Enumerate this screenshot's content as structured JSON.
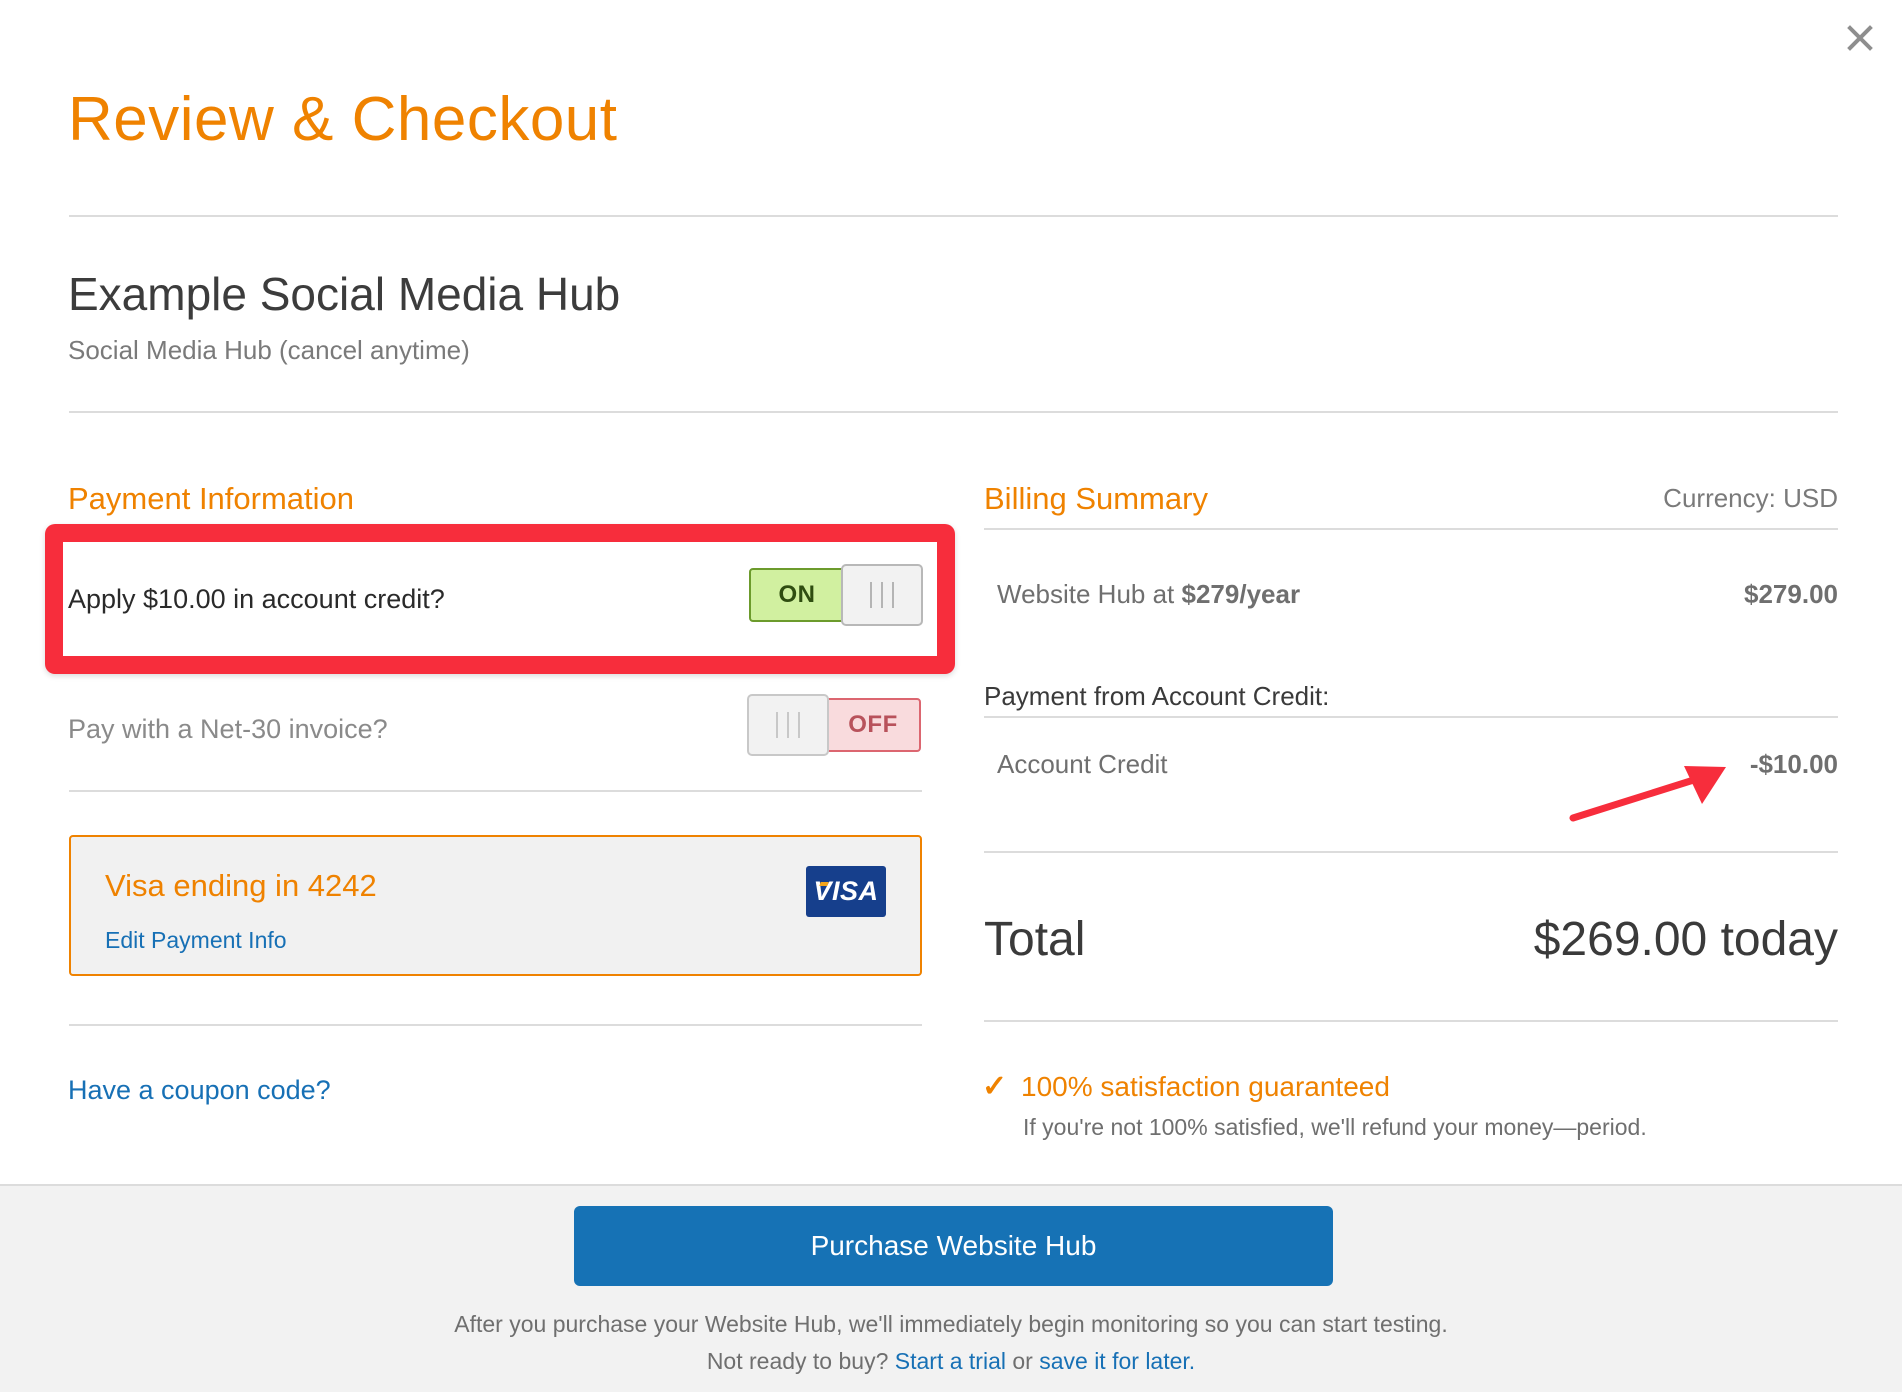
{
  "dialog": {
    "title": "Review & Checkout",
    "close_icon": "close-icon"
  },
  "product": {
    "name": "Example Social Media Hub",
    "subtitle": "Social Media Hub (cancel anytime)"
  },
  "payment": {
    "heading": "Payment Information",
    "credit_toggle": {
      "label": "Apply $10.00 in account credit?",
      "state": "ON",
      "on": true
    },
    "net30_toggle": {
      "label": "Pay with a Net-30 invoice?",
      "state": "OFF",
      "on": false
    },
    "card": {
      "label": "Visa ending in 4242",
      "edit_link": "Edit Payment Info",
      "brand": "VISA"
    },
    "coupon_link": "Have a coupon code?"
  },
  "billing": {
    "heading": "Billing Summary",
    "currency": "Currency: USD",
    "line_item": {
      "label_prefix": "Website Hub at ",
      "label_price": "$279/year",
      "amount": "$279.00"
    },
    "credit_section_heading": "Payment from Account Credit:",
    "credit_line": {
      "label": "Account Credit",
      "amount": "-$10.00"
    },
    "total_label": "Total",
    "total_amount": "$269.00 today",
    "guarantee": "100% satisfaction guaranteed",
    "guarantee_sub": "If you're not 100% satisfied, we'll refund your money—period."
  },
  "footer": {
    "purchase_button": "Purchase Website Hub",
    "text_1": "After you purchase your Website Hub, we'll immediately begin monitoring so you can start testing. Not ready to buy? ",
    "trial_link": "Start a trial",
    "text_2": " or ",
    "save_link": "save it for later."
  },
  "colors": {
    "accent": "#ef8200",
    "link": "#1770b5",
    "primary_button": "#1672b5",
    "annotation_red": "#f72d3c",
    "toggle_on": "#d1f0a0",
    "toggle_off": "#f9dbdd"
  }
}
